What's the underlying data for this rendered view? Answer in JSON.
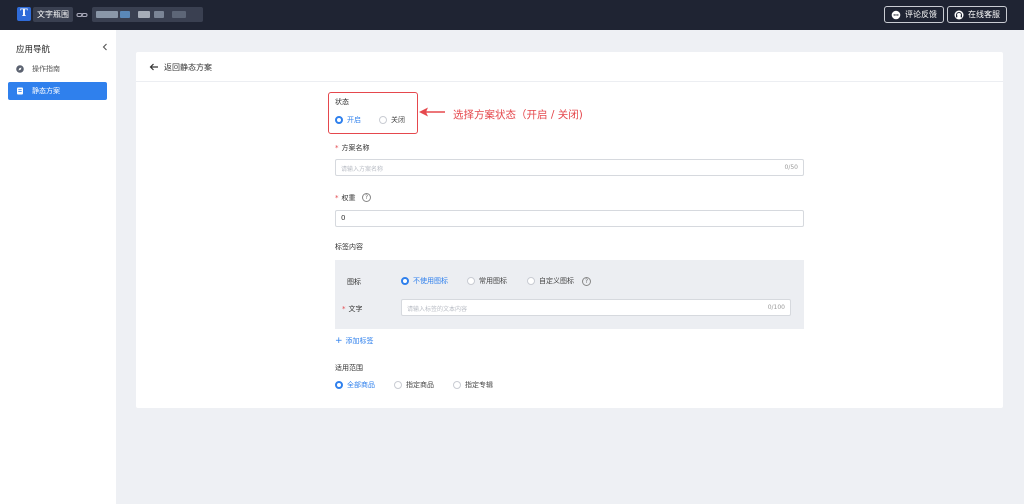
{
  "topbar": {
    "logo_letter": "T",
    "app_name": "文字瓶围",
    "feedback_label": "评论反馈",
    "service_label": "在线客服"
  },
  "sidebar": {
    "title": "应用导航",
    "items": [
      {
        "label": "操作指南",
        "icon": "compass-icon",
        "active": false
      },
      {
        "label": "静态方案",
        "icon": "document-icon",
        "active": true
      }
    ]
  },
  "page": {
    "back_label": "返回静态方案"
  },
  "form": {
    "status": {
      "label": "状态",
      "options": [
        "开启",
        "关闭"
      ],
      "selected": "开启"
    },
    "name": {
      "label": "方案名称",
      "placeholder": "请输入方案名称",
      "counter": "0/50"
    },
    "weight": {
      "label": "权重",
      "value": "0",
      "help": "?"
    },
    "tag_content": {
      "label": "标签内容",
      "icon_label": "图标",
      "icon_options": [
        "不使用图标",
        "常用图标",
        "自定义图标"
      ],
      "icon_selected": "不使用图标",
      "help": "?",
      "text_label": "文字",
      "text_placeholder": "请输入标签的文本内容",
      "text_counter": "0/100",
      "add_label": "添加标签"
    },
    "scope": {
      "label": "适用范围",
      "options": [
        "全部商品",
        "指定商品",
        "指定专辑"
      ],
      "selected": "全部商品"
    }
  },
  "annotation": {
    "text": "选择方案状态（开启 / 关闭)",
    "color": "#e5484d"
  },
  "colors": {
    "accent": "#2f80ed",
    "topbar": "#1f2433",
    "background": "#eef0f4"
  }
}
